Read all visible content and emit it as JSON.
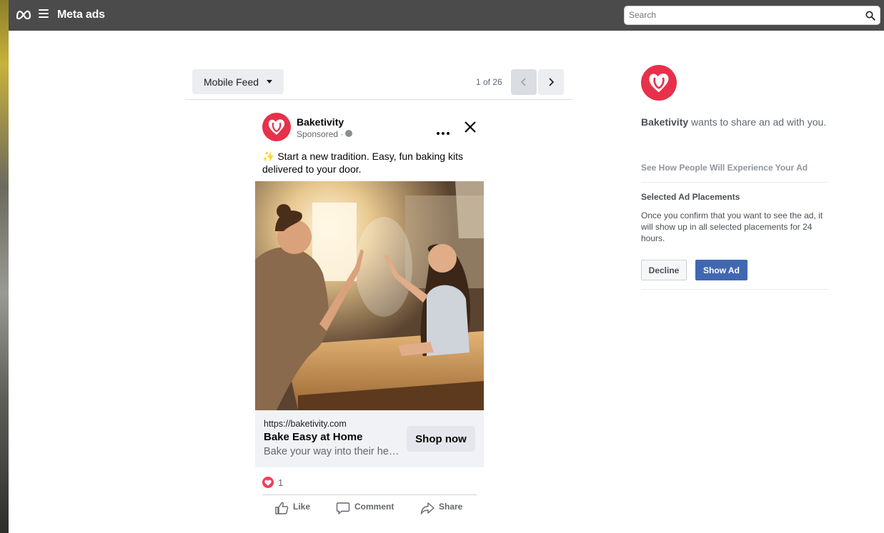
{
  "header": {
    "app_title": "Meta ads",
    "search_placeholder": "Search"
  },
  "preview": {
    "placement_label": "Mobile Feed",
    "pager_text": "1 of 26"
  },
  "ad": {
    "brand_name": "Baketivity",
    "sponsored_label": "Sponsored · ",
    "primary_text": "Start a new tradition. Easy, fun baking kits delivered to your door.",
    "link_url": "https://baketivity.com",
    "link_title": "Bake Easy at Home",
    "link_description": "Bake your way into their hearts",
    "cta_label": "Shop now",
    "reaction_count": "1",
    "actions": {
      "like": "Like",
      "comment": "Comment",
      "share": "Share"
    }
  },
  "sidebar": {
    "brand_name": "Baketivity",
    "share_text": " wants to share an ad with you.",
    "see_how_label": "See How People Will Experience Your Ad",
    "placements_title": "Selected Ad Placements",
    "placements_description": "Once you confirm that you want to see the ad, it will show up in all selected placements for 24 hours.",
    "decline_label": "Decline",
    "show_ad_label": "Show Ad"
  },
  "colors": {
    "brand_red": "#e8304a",
    "show_ad_blue": "#4267b2",
    "topbar": "#4b4b4b"
  }
}
